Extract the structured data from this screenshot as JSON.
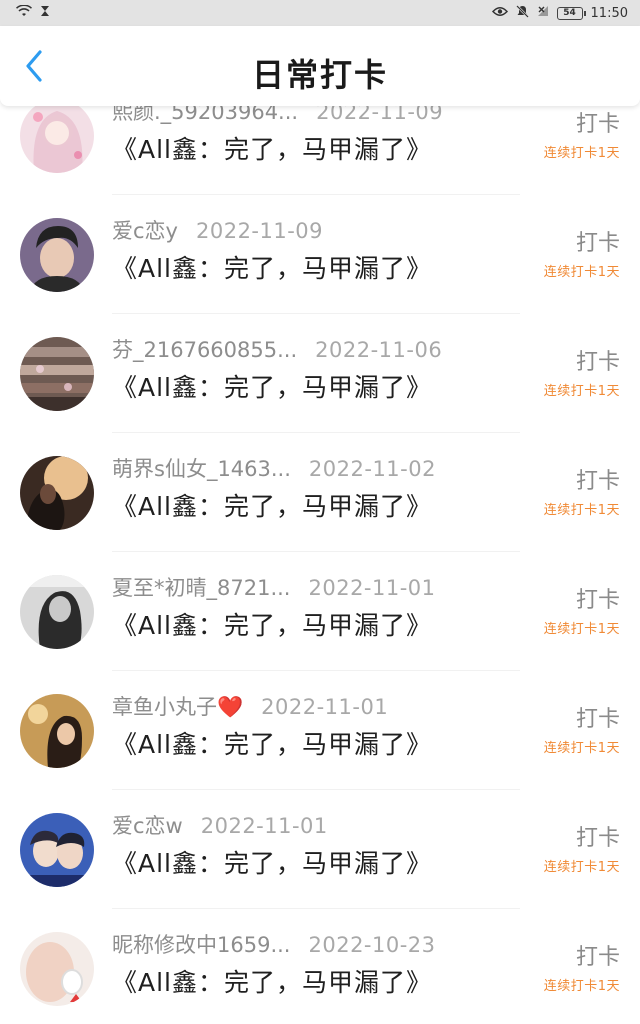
{
  "status_bar": {
    "left_icons": [
      "wifi-icon",
      "hourglass-icon"
    ],
    "right_icons": [
      "eye-icon",
      "mute-bell-icon",
      "signal-off-icon"
    ],
    "battery": "54",
    "time": "11:50"
  },
  "header": {
    "title": "日常打卡",
    "back_icon": "chevron-left-icon"
  },
  "colors": {
    "accent_blue": "#2d9cf0",
    "streak_orange": "#f08a36"
  },
  "entries": [
    {
      "name": "熙颜._59203964...",
      "date": "2022-11-09",
      "book": "《All鑫：完了，马甲漏了》",
      "action": "打卡",
      "streak": "连续打卡1天"
    },
    {
      "name": "爱c恋y",
      "date": "2022-11-09",
      "book": "《All鑫：完了，马甲漏了》",
      "action": "打卡",
      "streak": "连续打卡1天"
    },
    {
      "name": "芬_2167660855...",
      "date": "2022-11-06",
      "book": "《All鑫：完了，马甲漏了》",
      "action": "打卡",
      "streak": "连续打卡1天"
    },
    {
      "name": "萌界s仙女_1463...",
      "date": "2022-11-02",
      "book": "《All鑫：完了，马甲漏了》",
      "action": "打卡",
      "streak": "连续打卡1天"
    },
    {
      "name": "夏至*初晴_8721...",
      "date": "2022-11-01",
      "book": "《All鑫：完了，马甲漏了》",
      "action": "打卡",
      "streak": "连续打卡1天"
    },
    {
      "name": "章鱼小丸子❤️",
      "date": "2022-11-01",
      "book": "《All鑫：完了，马甲漏了》",
      "action": "打卡",
      "streak": "连续打卡1天"
    },
    {
      "name": "爱c恋w",
      "date": "2022-11-01",
      "book": "《All鑫：完了，马甲漏了》",
      "action": "打卡",
      "streak": "连续打卡1天"
    },
    {
      "name": "昵称修改中1659...",
      "date": "2022-10-23",
      "book": "《All鑫：完了，马甲漏了》",
      "action": "打卡",
      "streak": "连续打卡1天"
    }
  ]
}
